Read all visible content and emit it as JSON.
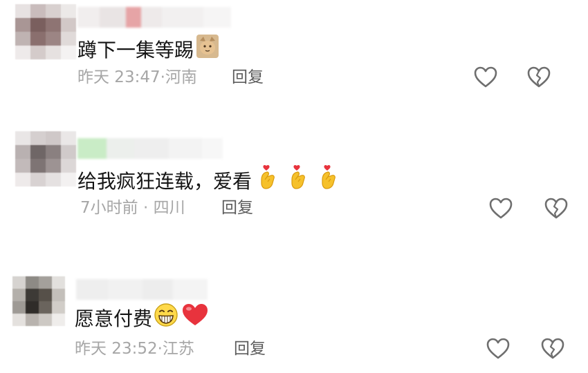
{
  "comments": [
    {
      "text": "蹲下一集等踢",
      "time": "昨天 23:47",
      "separator": "·",
      "location": "河南",
      "reply_label": "回复",
      "emojis": [
        "cat-face-icon"
      ]
    },
    {
      "text": "给我疯狂连载，爱看",
      "time": "7小时前",
      "separator": " · ",
      "location": "四川",
      "reply_label": "回复",
      "emojis": [
        "finger-heart-icon",
        "finger-heart-icon",
        "finger-heart-icon"
      ]
    },
    {
      "text": "愿意付费",
      "time": "昨天 23:52",
      "separator": "·",
      "location": "江苏",
      "reply_label": "回复",
      "emojis": [
        "grinning-face-icon",
        "red-heart-icon"
      ]
    }
  ],
  "colors": {
    "text": "#151515",
    "meta": "#a6a6a6",
    "reply": "#5c5c5c",
    "heart_red": "#e8333d",
    "icon_gray": "#6e6e6e"
  }
}
